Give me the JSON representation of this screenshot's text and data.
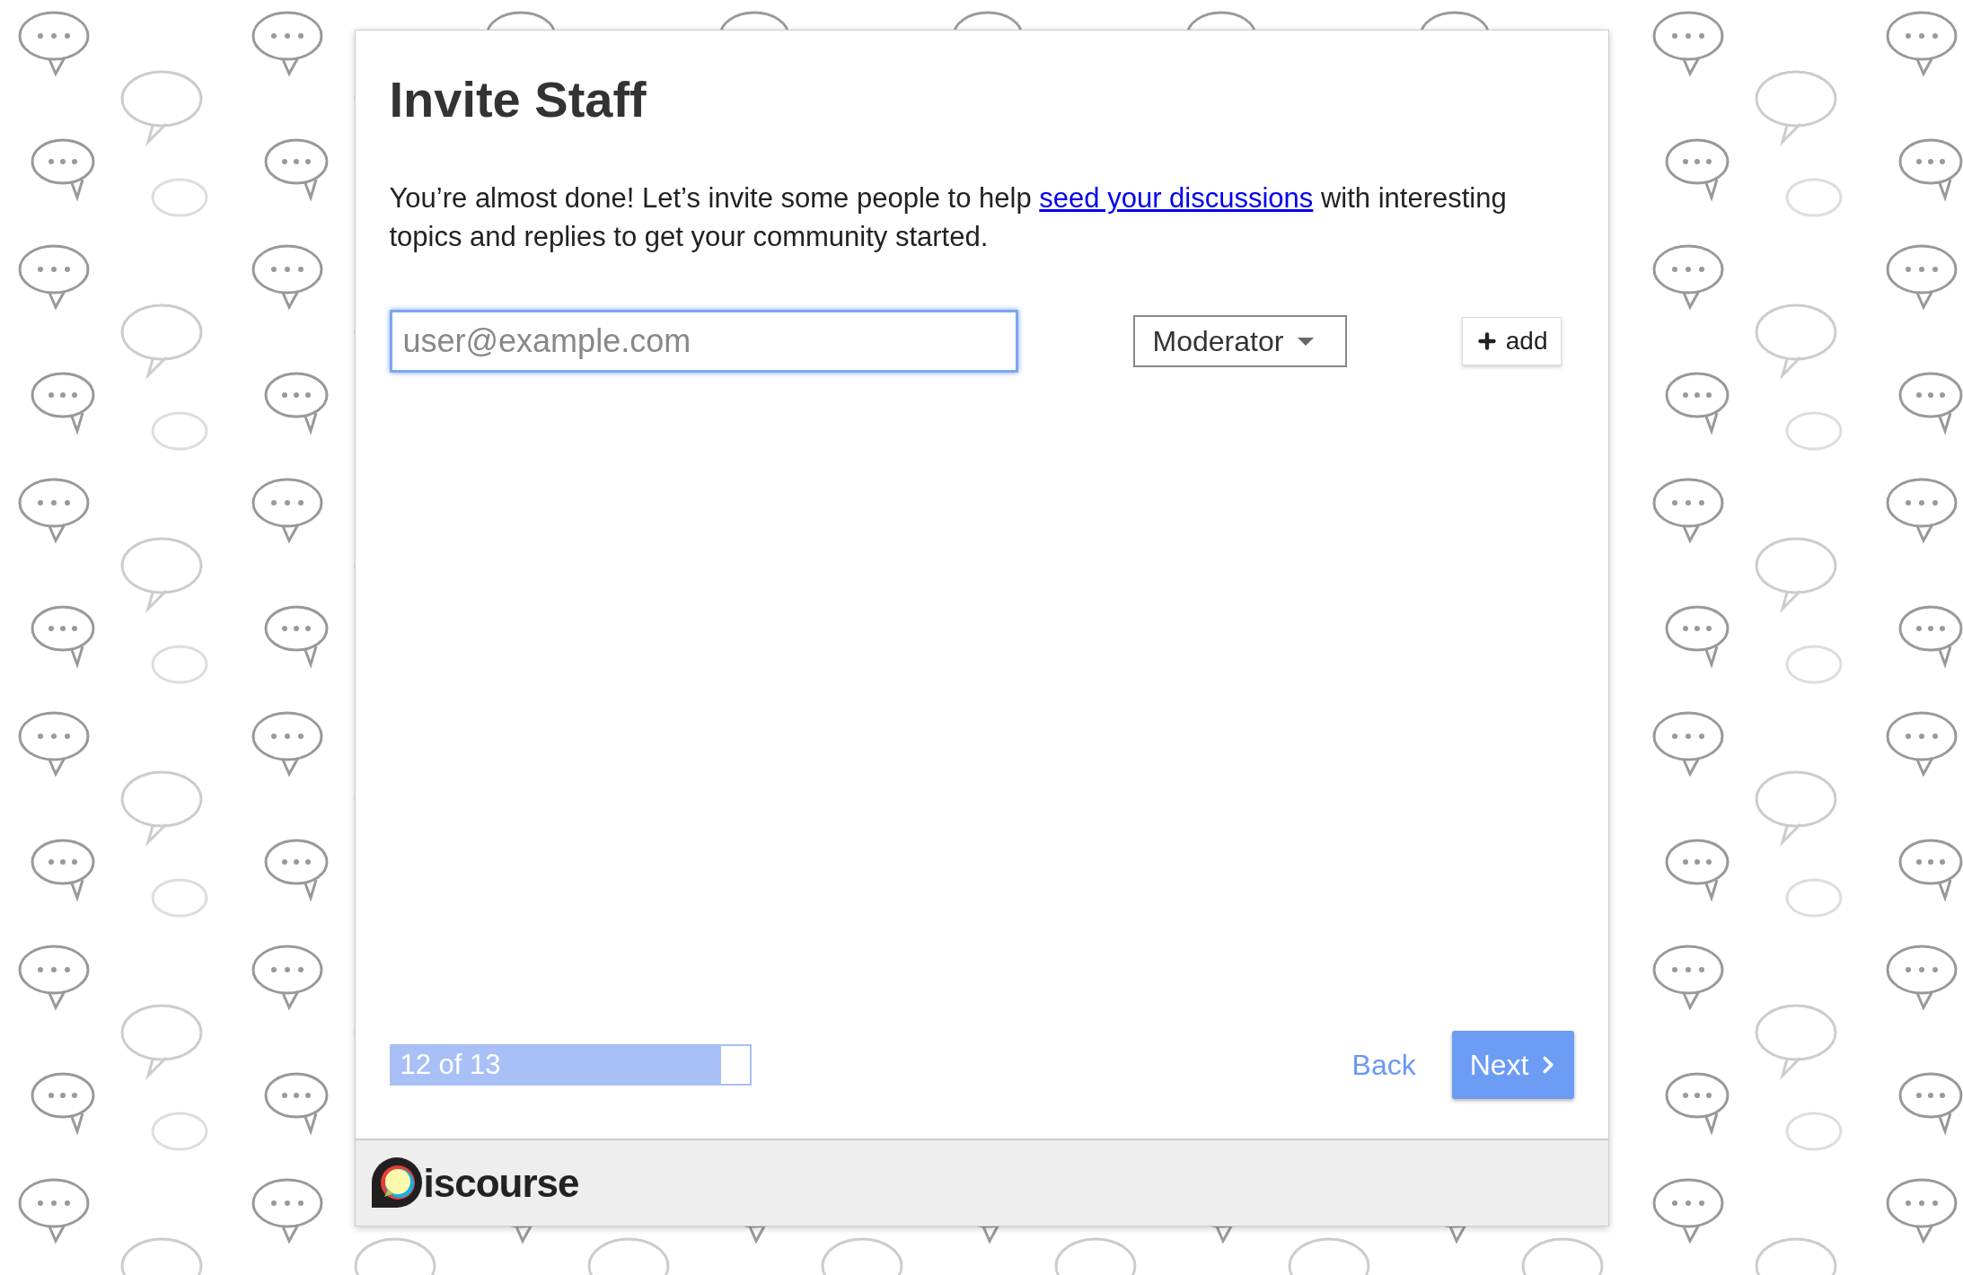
{
  "title": "Invite Staff",
  "intro": {
    "before": "You’re almost done! Let’s invite some people to help ",
    "link": "seed your discussions",
    "after": " with interesting topics and replies to get your community started."
  },
  "invite_form": {
    "email": {
      "placeholder": "user@example.com",
      "focused": true
    },
    "role": "Moderator",
    "add_button": "add"
  },
  "progress": {
    "label": "12 of 13",
    "level": 0.92
  },
  "buttons": {
    "back": "Back",
    "next": "Next"
  },
  "footer": {
    "logo_text": "iscourse"
  }
}
